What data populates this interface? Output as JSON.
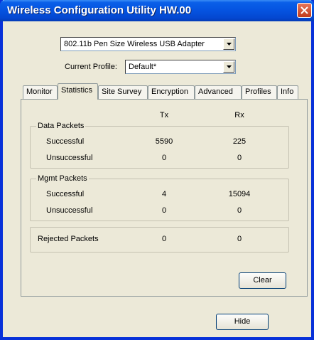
{
  "window": {
    "title": "Wireless Configuration Utility HW.00"
  },
  "adapter": {
    "selected": "802.11b Pen Size Wireless USB Adapter"
  },
  "profile": {
    "label": "Current Profile:",
    "selected": "Default*"
  },
  "tabs": [
    {
      "label": "Monitor"
    },
    {
      "label": "Statistics",
      "active": true
    },
    {
      "label": "Site Survey"
    },
    {
      "label": "Encryption"
    },
    {
      "label": "Advanced"
    },
    {
      "label": "Profiles"
    },
    {
      "label": "Info"
    }
  ],
  "stats": {
    "tx_header": "Tx",
    "rx_header": "Rx",
    "data": {
      "title": "Data Packets",
      "successful_label": "Successful",
      "successful_tx": "5590",
      "successful_rx": "225",
      "unsuccessful_label": "Unsuccessful",
      "unsuccessful_tx": "0",
      "unsuccessful_rx": "0"
    },
    "mgmt": {
      "title": "Mgmt Packets",
      "successful_label": "Successful",
      "successful_tx": "4",
      "successful_rx": "15094",
      "unsuccessful_label": "Unsuccessful",
      "unsuccessful_tx": "0",
      "unsuccessful_rx": "0"
    },
    "rejected": {
      "label": "Rejected Packets",
      "tx": "0",
      "rx": "0"
    }
  },
  "buttons": {
    "clear": "Clear",
    "hide": "Hide"
  }
}
